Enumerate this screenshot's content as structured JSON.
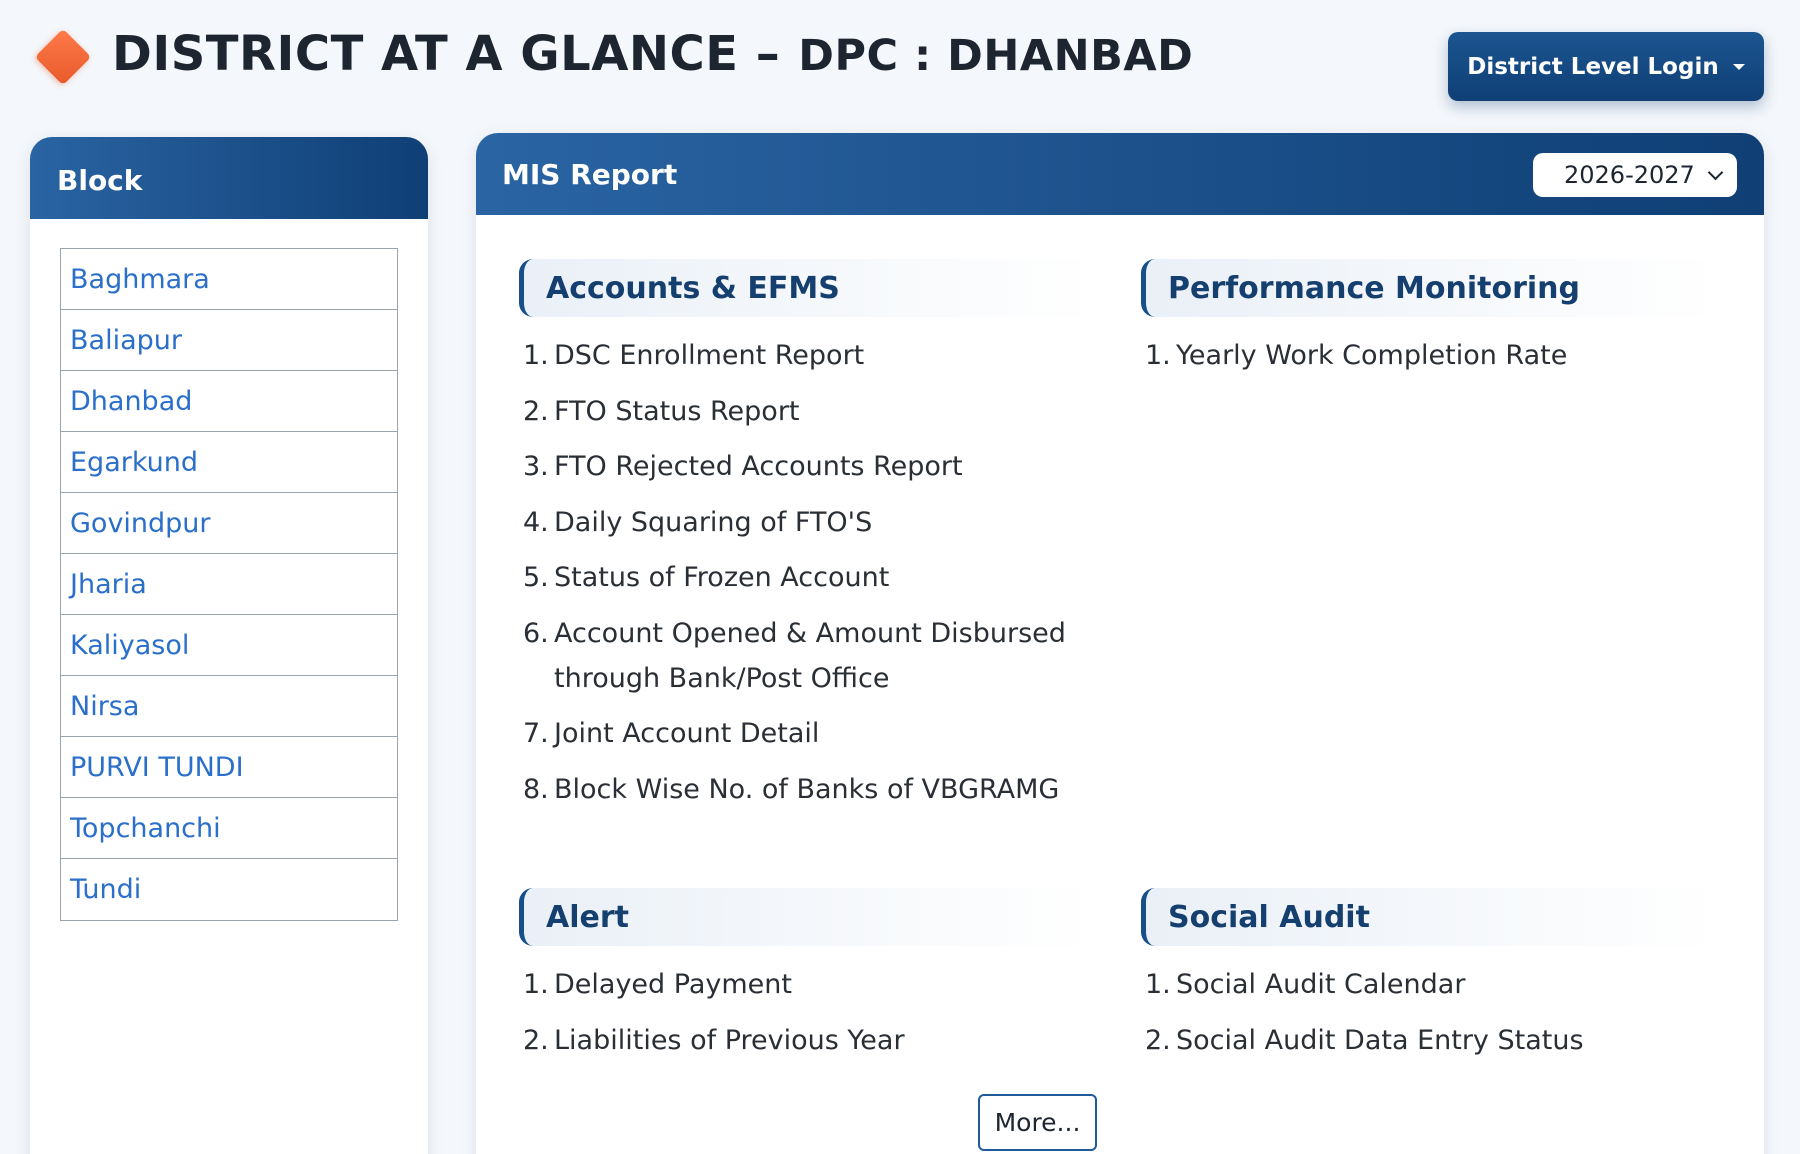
{
  "header": {
    "title_main": "DISTRICT AT A GLANCE –",
    "title_sub": "DPC : DHANBAD",
    "login_label": "District Level Login"
  },
  "block_panel": {
    "title": "Block",
    "items": [
      {
        "label": "Baghmara"
      },
      {
        "label": "Baliapur"
      },
      {
        "label": "Dhanbad"
      },
      {
        "label": "Egarkund"
      },
      {
        "label": "Govindpur"
      },
      {
        "label": "Jharia"
      },
      {
        "label": "Kaliyasol"
      },
      {
        "label": "Nirsa"
      },
      {
        "label": "PURVI TUNDI"
      },
      {
        "label": "Topchanchi"
      },
      {
        "label": "Tundi"
      }
    ]
  },
  "mis": {
    "title": "MIS Report",
    "year": "2026-2027",
    "sections": {
      "accounts": {
        "title": "Accounts & EFMS",
        "items": [
          {
            "num": "1.",
            "label": "DSC Enrollment Report"
          },
          {
            "num": "2.",
            "label": "FTO Status Report"
          },
          {
            "num": "3.",
            "label": "FTO Rejected Accounts Report"
          },
          {
            "num": "4.",
            "label": "Daily Squaring of FTO'S"
          },
          {
            "num": "5.",
            "label": "Status of Frozen Account"
          },
          {
            "num": "6.",
            "label": "Account Opened & Amount Disbursed through Bank/Post Office"
          },
          {
            "num": "7.",
            "label": "Joint Account Detail"
          },
          {
            "num": "8.",
            "label": "Block Wise No. of Banks of VBGRAMG"
          }
        ]
      },
      "performance": {
        "title": "Performance Monitoring",
        "items": [
          {
            "num": "1.",
            "label": "Yearly Work Completion Rate"
          }
        ]
      },
      "alert": {
        "title": "Alert",
        "items": [
          {
            "num": "1.",
            "label": "Delayed Payment"
          },
          {
            "num": "2.",
            "label": "Liabilities of Previous Year"
          }
        ]
      },
      "social_audit": {
        "title": "Social Audit",
        "items": [
          {
            "num": "1.",
            "label": "Social Audit Calendar"
          },
          {
            "num": "2.",
            "label": "Social Audit Data Entry Status"
          }
        ]
      }
    },
    "more_label": "More..."
  }
}
